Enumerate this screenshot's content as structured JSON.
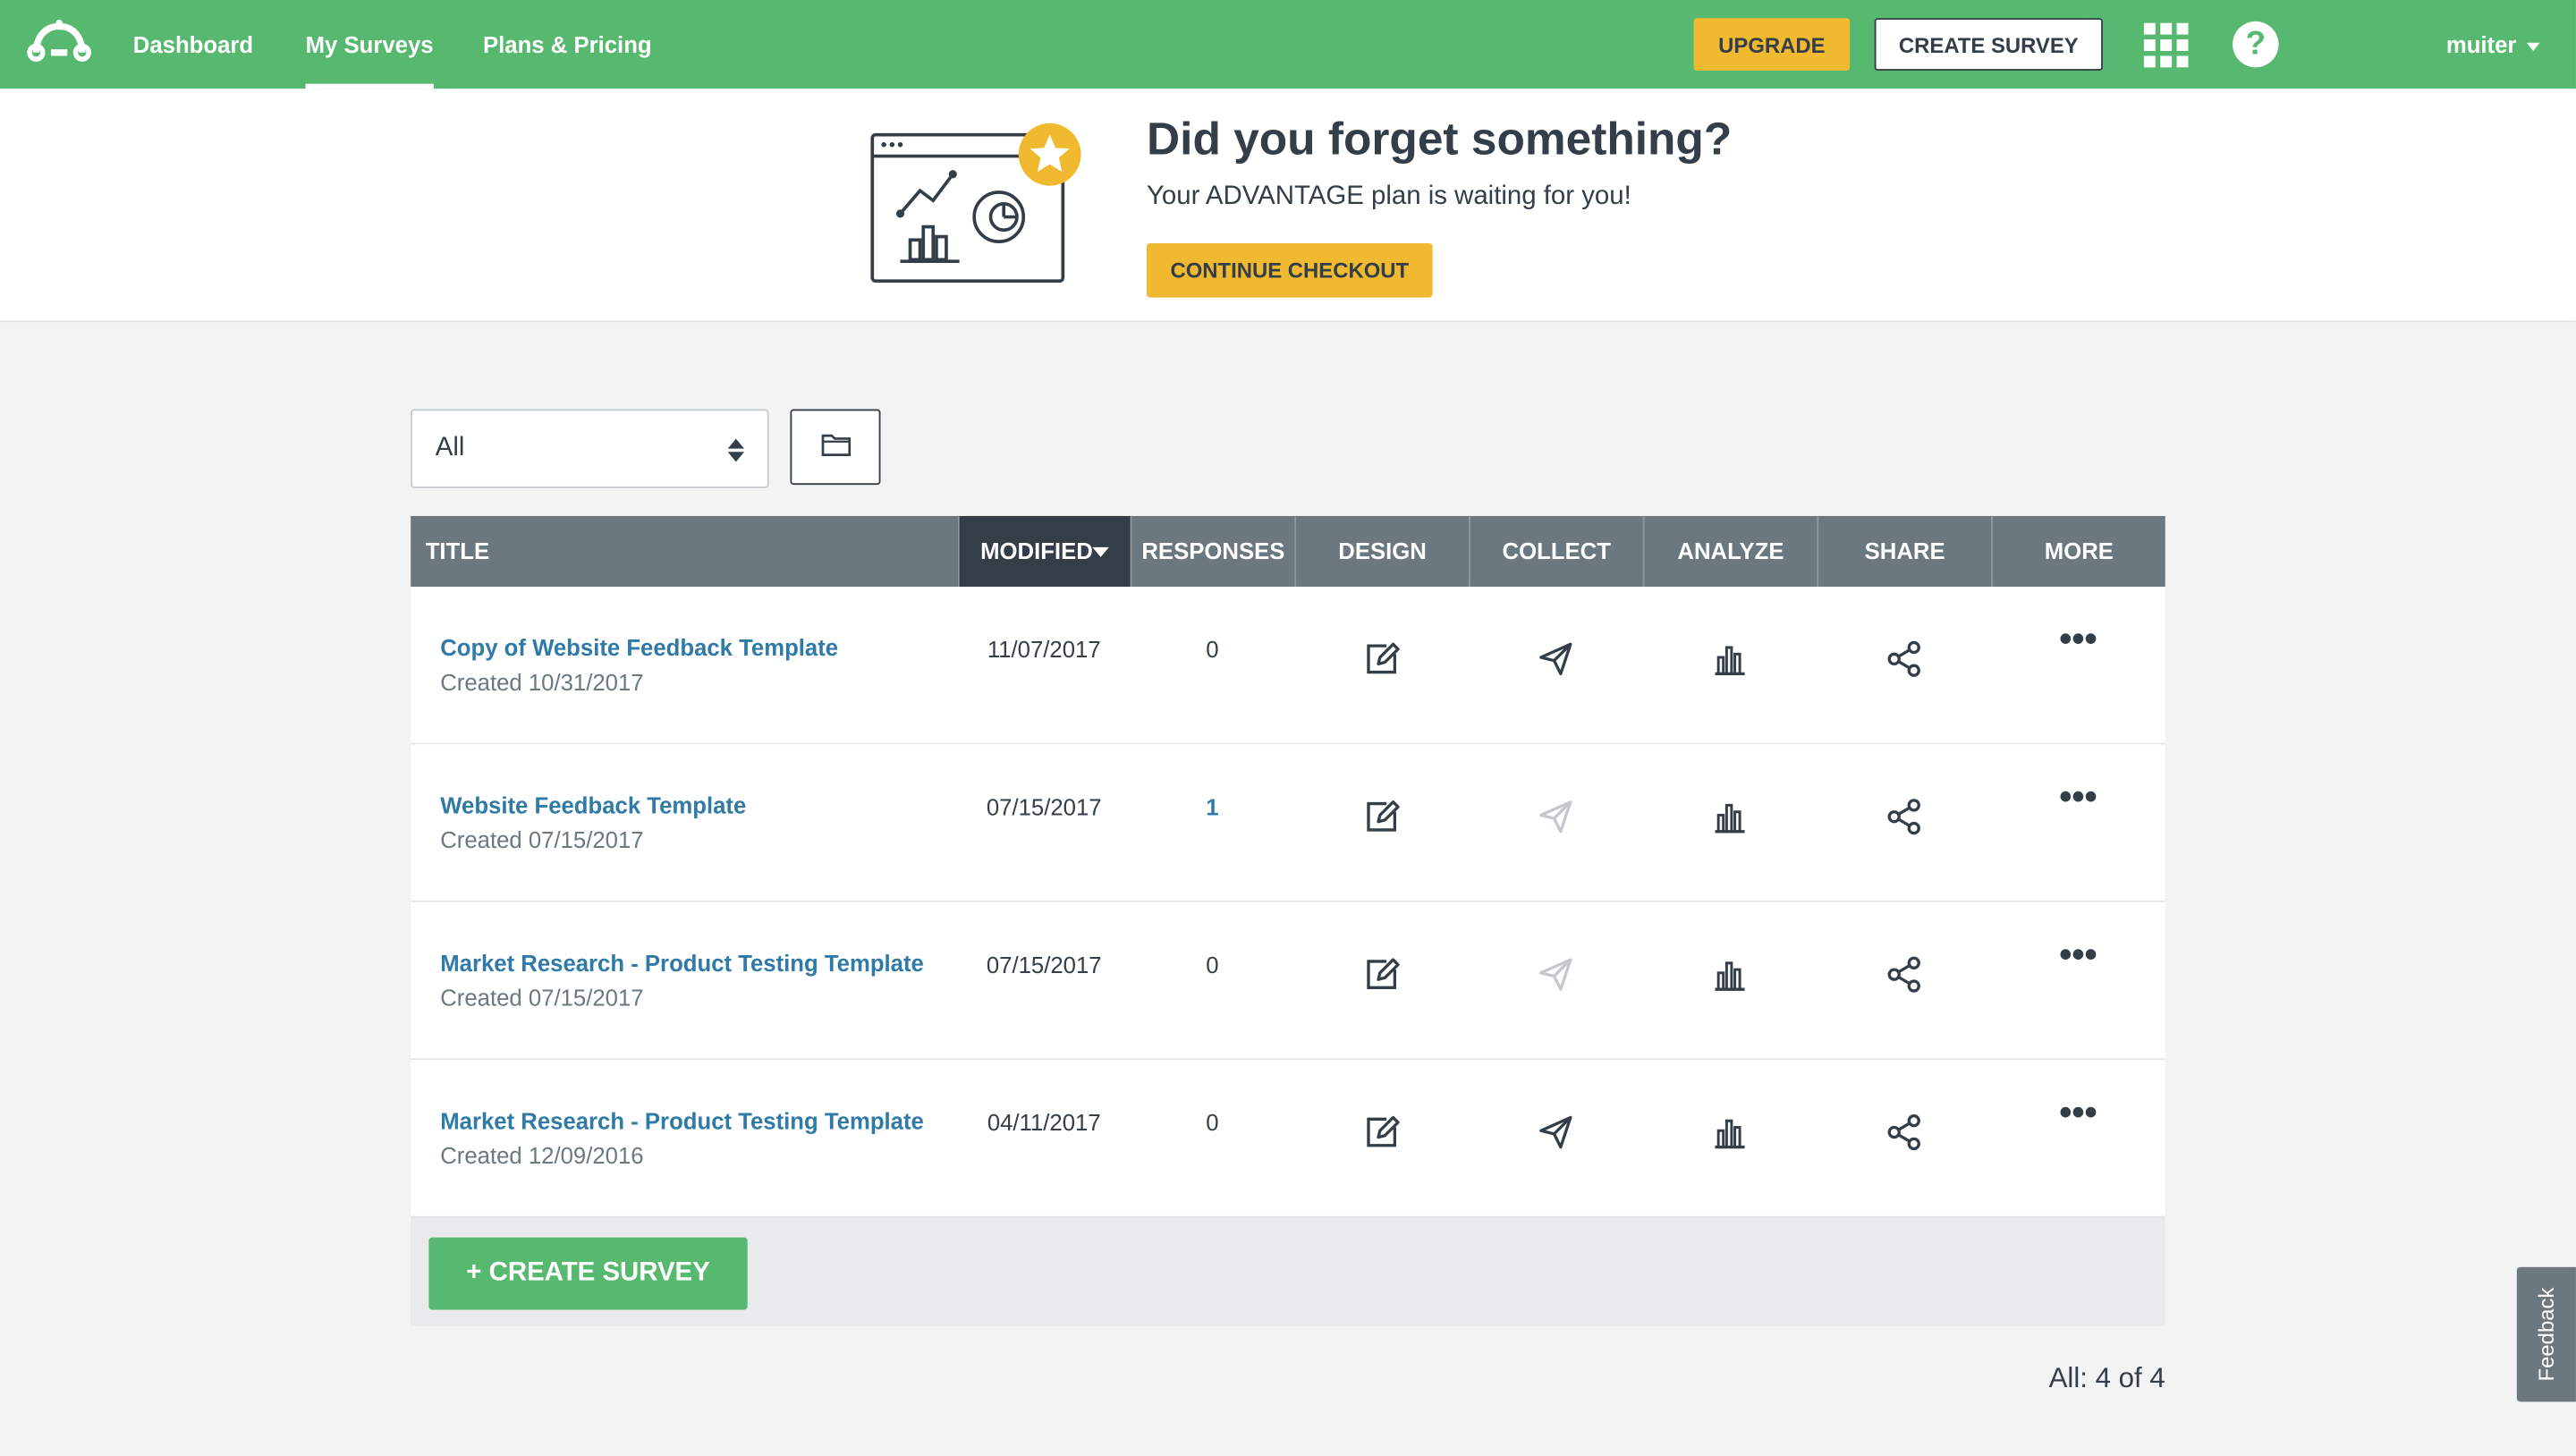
{
  "nav": {
    "links": [
      "Dashboard",
      "My Surveys",
      "Plans & Pricing"
    ],
    "upgrade_label": "UPGRADE",
    "create_label": "CREATE SURVEY",
    "help_glyph": "?",
    "username": "muiter",
    "logo_icon": "surveymonkey-logo-icon",
    "apps_icon": "apps-grid-icon"
  },
  "banner": {
    "title": "Did you forget something?",
    "subtitle": "Your ADVANTAGE plan is waiting for you!",
    "cta": "CONTINUE CHECKOUT"
  },
  "filter": {
    "selected": "All"
  },
  "table": {
    "headers": [
      "TITLE",
      "MODIFIED",
      "RESPONSES",
      "DESIGN",
      "COLLECT",
      "ANALYZE",
      "SHARE",
      "MORE"
    ],
    "rows": [
      {
        "title": "Copy of Website Feedback Template",
        "created": "Created 10/31/2017",
        "modified": "11/07/2017",
        "responses": "0",
        "collect_active": true
      },
      {
        "title": "Website Feedback Template",
        "created": "Created 07/15/2017",
        "modified": "07/15/2017",
        "responses": "1",
        "collect_active": false
      },
      {
        "title": "Market Research - Product Testing Template",
        "created": "Created 07/15/2017",
        "modified": "07/15/2017",
        "responses": "0",
        "collect_active": false
      },
      {
        "title": "Market Research - Product Testing Template",
        "created": "Created 12/09/2016",
        "modified": "04/11/2017",
        "responses": "0",
        "collect_active": true
      }
    ],
    "more_glyph": "•••",
    "create_bottom": "+ CREATE SURVEY"
  },
  "count": "All: 4 of 4",
  "feedback": "Feedback",
  "colors": {
    "brand_green": "#57b96f",
    "accent_yellow": "#f1b930",
    "link_blue": "#2f7aa6",
    "header_gray": "#6b787f",
    "header_dark": "#333e48"
  }
}
